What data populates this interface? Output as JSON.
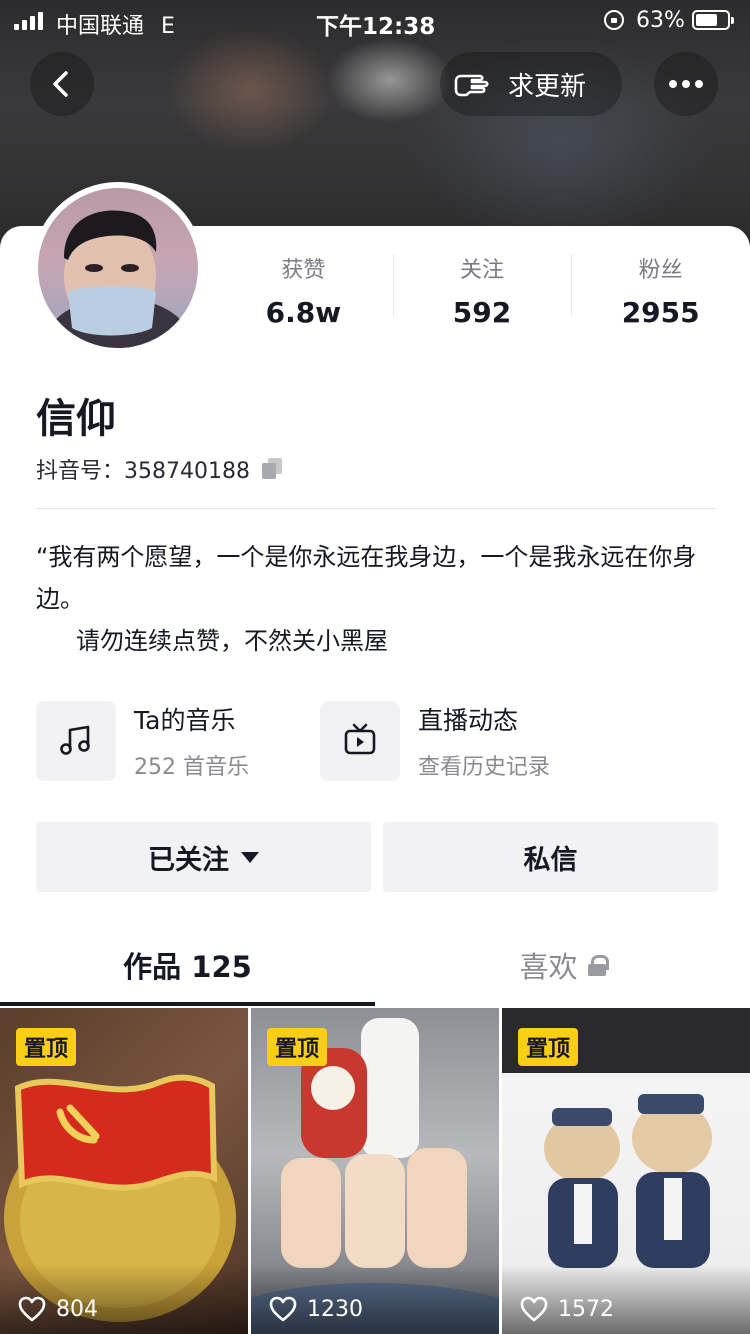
{
  "status_bar": {
    "carrier": "中国联通",
    "network": "E",
    "time": "下午12:38",
    "battery_percent": "63%",
    "battery_level": 0.63
  },
  "header": {
    "update_button_label": "求更新"
  },
  "stats": [
    {
      "label": "获赞",
      "value": "6.8w"
    },
    {
      "label": "关注",
      "value": "592"
    },
    {
      "label": "粉丝",
      "value": "2955"
    }
  ],
  "profile": {
    "name": "信仰",
    "douyin_id": "抖音号：358740188",
    "bio_line1": "“我有两个愿望，一个是你永远在我身边，一个是我永远在你身边。",
    "bio_line2": "请勿连续点赞，不然关小黑屋"
  },
  "entries": [
    {
      "title": "Ta的音乐",
      "subtitle": "252 首音乐",
      "icon": "music-note-icon"
    },
    {
      "title": "直播动态",
      "subtitle": "查看历史记录",
      "icon": "tv-play-icon"
    }
  ],
  "buttons": {
    "follow_label": "已关注",
    "message_label": "私信"
  },
  "tabs": [
    {
      "label": "作品 125",
      "active": true
    },
    {
      "label": "喜欢",
      "active": false,
      "locked": true
    }
  ],
  "videos": [
    {
      "badge": "置顶",
      "likes": "804"
    },
    {
      "badge": "置顶",
      "likes": "1230"
    },
    {
      "badge": "置顶",
      "likes": "1572"
    }
  ],
  "colors": {
    "accent_yellow": "#face15",
    "text_primary": "#161823",
    "text_secondary": "#8a8b91"
  }
}
